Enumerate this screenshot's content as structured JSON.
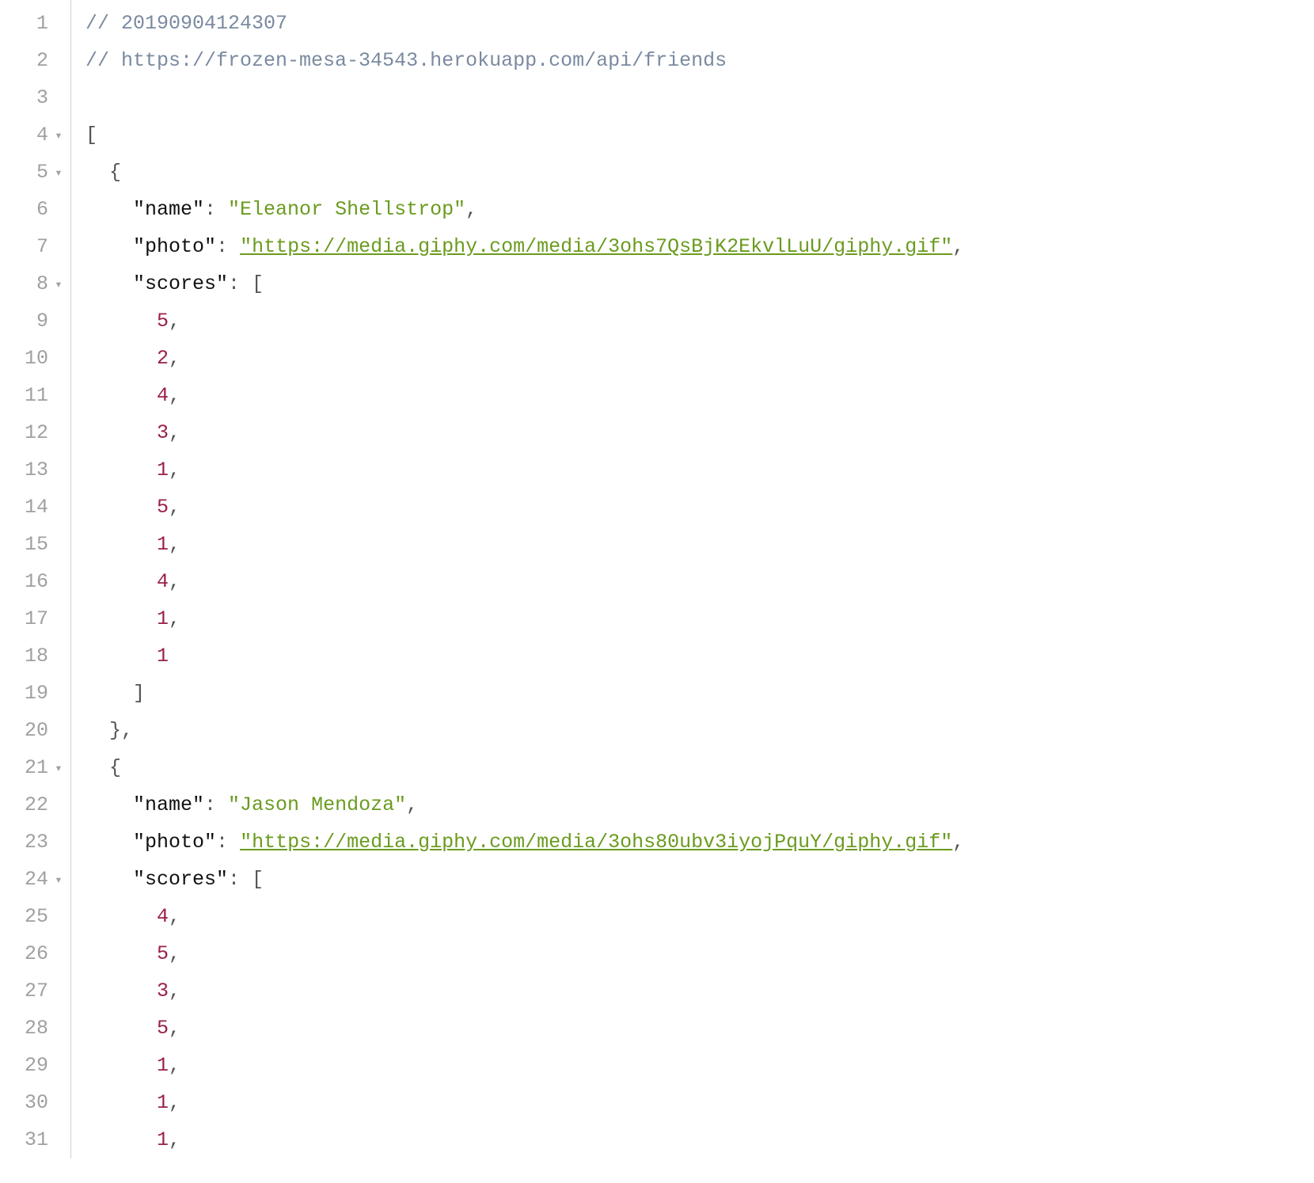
{
  "lines": [
    {
      "n": "1",
      "fold": "",
      "segs": [
        {
          "cls": "c-comment",
          "t": "// 20190904124307"
        }
      ]
    },
    {
      "n": "2",
      "fold": "",
      "segs": [
        {
          "cls": "c-comment",
          "t": "// https://frozen-mesa-34543.herokuapp.com/api/friends"
        }
      ]
    },
    {
      "n": "3",
      "fold": "",
      "segs": []
    },
    {
      "n": "4",
      "fold": "▾",
      "segs": [
        {
          "cls": "c-punc",
          "t": "["
        }
      ]
    },
    {
      "n": "5",
      "fold": "▾",
      "segs": [
        {
          "cls": "c-punc",
          "t": "  {"
        }
      ]
    },
    {
      "n": "6",
      "fold": "",
      "segs": [
        {
          "cls": "c-punc",
          "t": "    "
        },
        {
          "cls": "c-key",
          "t": "\"name\""
        },
        {
          "cls": "c-punc",
          "t": ": "
        },
        {
          "cls": "c-str",
          "t": "\"Eleanor Shellstrop\""
        },
        {
          "cls": "c-punc",
          "t": ","
        }
      ]
    },
    {
      "n": "7",
      "fold": "",
      "segs": [
        {
          "cls": "c-punc",
          "t": "    "
        },
        {
          "cls": "c-key",
          "t": "\"photo\""
        },
        {
          "cls": "c-punc",
          "t": ": "
        },
        {
          "cls": "c-link",
          "t": "\"https://media.giphy.com/media/3ohs7QsBjK2EkvlLuU/giphy.gif\""
        },
        {
          "cls": "c-punc",
          "t": ","
        }
      ]
    },
    {
      "n": "8",
      "fold": "▾",
      "segs": [
        {
          "cls": "c-punc",
          "t": "    "
        },
        {
          "cls": "c-key",
          "t": "\"scores\""
        },
        {
          "cls": "c-punc",
          "t": ": ["
        }
      ]
    },
    {
      "n": "9",
      "fold": "",
      "segs": [
        {
          "cls": "c-punc",
          "t": "      "
        },
        {
          "cls": "c-num",
          "t": "5"
        },
        {
          "cls": "c-punc",
          "t": ","
        }
      ]
    },
    {
      "n": "10",
      "fold": "",
      "segs": [
        {
          "cls": "c-punc",
          "t": "      "
        },
        {
          "cls": "c-num",
          "t": "2"
        },
        {
          "cls": "c-punc",
          "t": ","
        }
      ]
    },
    {
      "n": "11",
      "fold": "",
      "segs": [
        {
          "cls": "c-punc",
          "t": "      "
        },
        {
          "cls": "c-num",
          "t": "4"
        },
        {
          "cls": "c-punc",
          "t": ","
        }
      ]
    },
    {
      "n": "12",
      "fold": "",
      "segs": [
        {
          "cls": "c-punc",
          "t": "      "
        },
        {
          "cls": "c-num",
          "t": "3"
        },
        {
          "cls": "c-punc",
          "t": ","
        }
      ]
    },
    {
      "n": "13",
      "fold": "",
      "segs": [
        {
          "cls": "c-punc",
          "t": "      "
        },
        {
          "cls": "c-num",
          "t": "1"
        },
        {
          "cls": "c-punc",
          "t": ","
        }
      ]
    },
    {
      "n": "14",
      "fold": "",
      "segs": [
        {
          "cls": "c-punc",
          "t": "      "
        },
        {
          "cls": "c-num",
          "t": "5"
        },
        {
          "cls": "c-punc",
          "t": ","
        }
      ]
    },
    {
      "n": "15",
      "fold": "",
      "segs": [
        {
          "cls": "c-punc",
          "t": "      "
        },
        {
          "cls": "c-num",
          "t": "1"
        },
        {
          "cls": "c-punc",
          "t": ","
        }
      ]
    },
    {
      "n": "16",
      "fold": "",
      "segs": [
        {
          "cls": "c-punc",
          "t": "      "
        },
        {
          "cls": "c-num",
          "t": "4"
        },
        {
          "cls": "c-punc",
          "t": ","
        }
      ]
    },
    {
      "n": "17",
      "fold": "",
      "segs": [
        {
          "cls": "c-punc",
          "t": "      "
        },
        {
          "cls": "c-num",
          "t": "1"
        },
        {
          "cls": "c-punc",
          "t": ","
        }
      ]
    },
    {
      "n": "18",
      "fold": "",
      "segs": [
        {
          "cls": "c-punc",
          "t": "      "
        },
        {
          "cls": "c-num",
          "t": "1"
        }
      ]
    },
    {
      "n": "19",
      "fold": "",
      "segs": [
        {
          "cls": "c-punc",
          "t": "    ]"
        }
      ]
    },
    {
      "n": "20",
      "fold": "",
      "segs": [
        {
          "cls": "c-punc",
          "t": "  },"
        }
      ]
    },
    {
      "n": "21",
      "fold": "▾",
      "segs": [
        {
          "cls": "c-punc",
          "t": "  {"
        }
      ]
    },
    {
      "n": "22",
      "fold": "",
      "segs": [
        {
          "cls": "c-punc",
          "t": "    "
        },
        {
          "cls": "c-key",
          "t": "\"name\""
        },
        {
          "cls": "c-punc",
          "t": ": "
        },
        {
          "cls": "c-str",
          "t": "\"Jason Mendoza\""
        },
        {
          "cls": "c-punc",
          "t": ","
        }
      ]
    },
    {
      "n": "23",
      "fold": "",
      "segs": [
        {
          "cls": "c-punc",
          "t": "    "
        },
        {
          "cls": "c-key",
          "t": "\"photo\""
        },
        {
          "cls": "c-punc",
          "t": ": "
        },
        {
          "cls": "c-link",
          "t": "\"https://media.giphy.com/media/3ohs80ubv3iyojPquY/giphy.gif\""
        },
        {
          "cls": "c-punc",
          "t": ","
        }
      ]
    },
    {
      "n": "24",
      "fold": "▾",
      "segs": [
        {
          "cls": "c-punc",
          "t": "    "
        },
        {
          "cls": "c-key",
          "t": "\"scores\""
        },
        {
          "cls": "c-punc",
          "t": ": ["
        }
      ]
    },
    {
      "n": "25",
      "fold": "",
      "segs": [
        {
          "cls": "c-punc",
          "t": "      "
        },
        {
          "cls": "c-num",
          "t": "4"
        },
        {
          "cls": "c-punc",
          "t": ","
        }
      ]
    },
    {
      "n": "26",
      "fold": "",
      "segs": [
        {
          "cls": "c-punc",
          "t": "      "
        },
        {
          "cls": "c-num",
          "t": "5"
        },
        {
          "cls": "c-punc",
          "t": ","
        }
      ]
    },
    {
      "n": "27",
      "fold": "",
      "segs": [
        {
          "cls": "c-punc",
          "t": "      "
        },
        {
          "cls": "c-num",
          "t": "3"
        },
        {
          "cls": "c-punc",
          "t": ","
        }
      ]
    },
    {
      "n": "28",
      "fold": "",
      "segs": [
        {
          "cls": "c-punc",
          "t": "      "
        },
        {
          "cls": "c-num",
          "t": "5"
        },
        {
          "cls": "c-punc",
          "t": ","
        }
      ]
    },
    {
      "n": "29",
      "fold": "",
      "segs": [
        {
          "cls": "c-punc",
          "t": "      "
        },
        {
          "cls": "c-num",
          "t": "1"
        },
        {
          "cls": "c-punc",
          "t": ","
        }
      ]
    },
    {
      "n": "30",
      "fold": "",
      "segs": [
        {
          "cls": "c-punc",
          "t": "      "
        },
        {
          "cls": "c-num",
          "t": "1"
        },
        {
          "cls": "c-punc",
          "t": ","
        }
      ]
    },
    {
      "n": "31",
      "fold": "",
      "segs": [
        {
          "cls": "c-punc",
          "t": "      "
        },
        {
          "cls": "c-num",
          "t": "1"
        },
        {
          "cls": "c-punc",
          "t": ","
        }
      ]
    }
  ]
}
